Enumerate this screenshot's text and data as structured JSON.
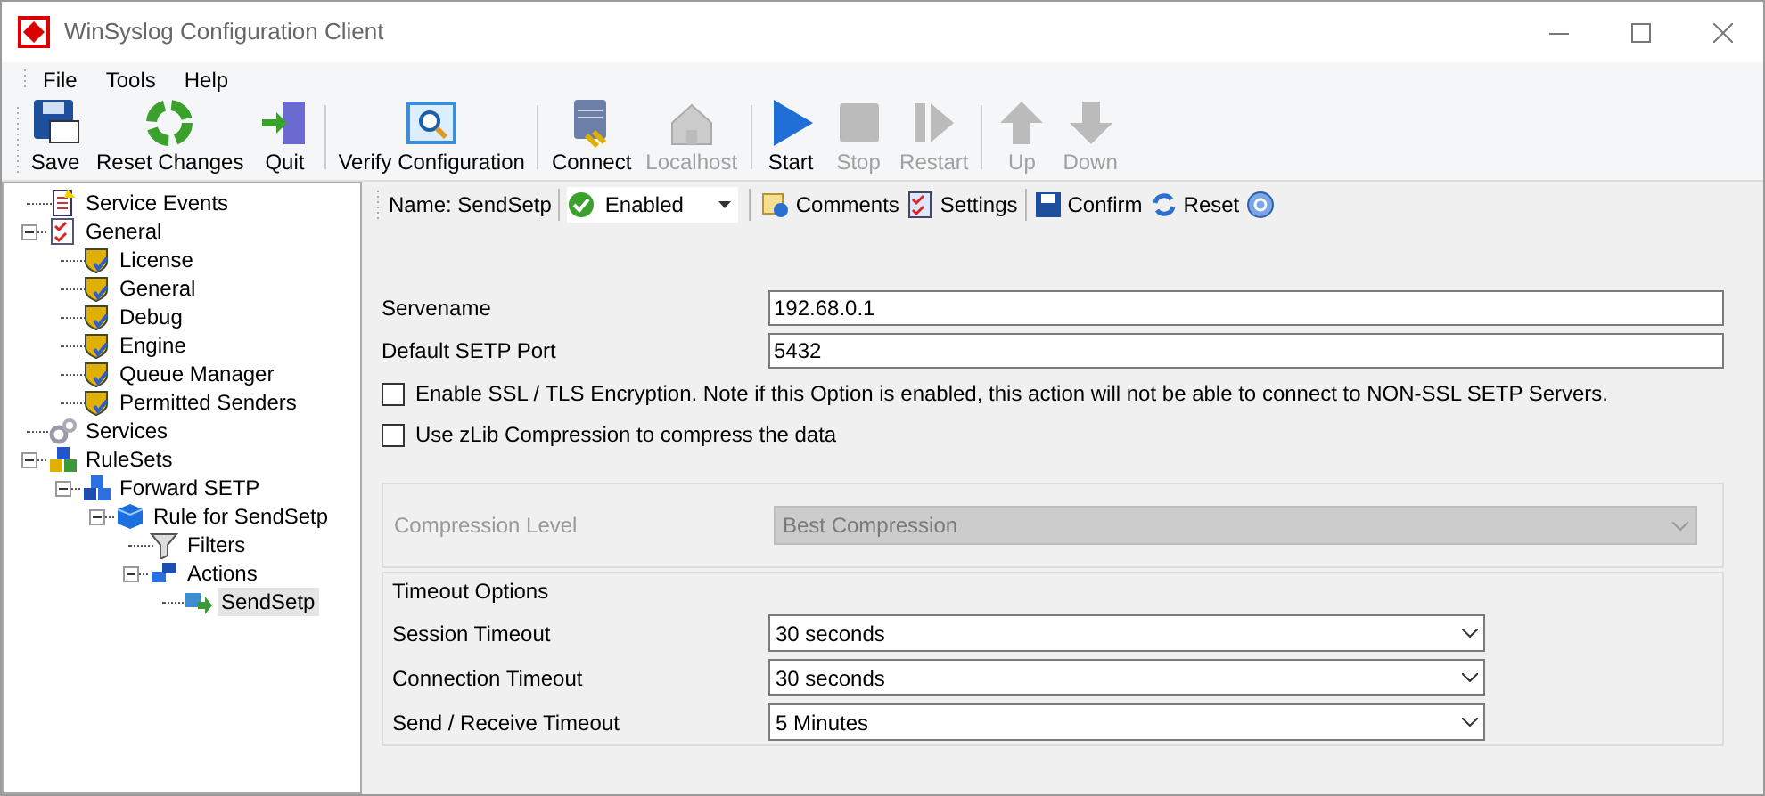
{
  "window": {
    "title": "WinSyslog Configuration Client"
  },
  "menu": [
    "File",
    "Tools",
    "Help"
  ],
  "toolbar": [
    [
      {
        "label": "Save",
        "disabled": false
      },
      {
        "label": "Reset Changes",
        "disabled": false
      },
      {
        "label": "Quit",
        "disabled": false
      }
    ],
    [
      {
        "label": "Verify Configuration",
        "disabled": false
      }
    ],
    [
      {
        "label": "Connect",
        "disabled": false
      },
      {
        "label": "Localhost",
        "disabled": true
      }
    ],
    [
      {
        "label": "Start",
        "disabled": false
      },
      {
        "label": "Stop",
        "disabled": true
      },
      {
        "label": "Restart",
        "disabled": true
      }
    ],
    [
      {
        "label": "Up",
        "disabled": true
      },
      {
        "label": "Down",
        "disabled": true
      }
    ]
  ],
  "tree": [
    {
      "label": "Service Events",
      "selected": false
    },
    {
      "label": "General",
      "selected": false,
      "expanded": true,
      "children": [
        {
          "label": "License",
          "selected": false
        },
        {
          "label": "General",
          "selected": false
        },
        {
          "label": "Debug",
          "selected": false
        },
        {
          "label": "Engine",
          "selected": false
        },
        {
          "label": "Queue Manager",
          "selected": false
        },
        {
          "label": "Permitted Senders",
          "selected": false
        }
      ]
    },
    {
      "label": "Services",
      "selected": false
    },
    {
      "label": "RuleSets",
      "selected": false,
      "expanded": true,
      "children": [
        {
          "label": "Forward SETP",
          "selected": false,
          "expanded": true,
          "children": [
            {
              "label": "Rule for SendSetp",
              "selected": false,
              "expanded": true,
              "children": [
                {
                  "label": "Filters",
                  "selected": false
                },
                {
                  "label": "Actions",
                  "selected": false,
                  "expanded": true,
                  "children": [
                    {
                      "label": "SendSetp",
                      "selected": true
                    }
                  ]
                }
              ]
            }
          ]
        }
      ]
    }
  ],
  "action_bar": {
    "name_label": "Name: SendSetp",
    "status": "Enabled",
    "buttons": [
      "Comments",
      "Settings",
      "Confirm",
      "Reset"
    ]
  },
  "form": {
    "fields": [
      {
        "label": "Servename",
        "value": "192.68.0.1"
      },
      {
        "label": "Default SETP Port",
        "value": "5432"
      }
    ],
    "checkboxes": [
      {
        "label": "Enable SSL / TLS Encryption. Note if this Option is enabled, this action will not be able to connect to NON-SSL SETP Servers.",
        "checked": false
      },
      {
        "label": "Use zLib Compression to compress the data",
        "checked": false
      }
    ],
    "compression": {
      "label": "Compression Level",
      "value": "Best Compression",
      "disabled": true
    },
    "timeout_group": {
      "title": "Timeout Options",
      "rows": [
        {
          "label": "Session Timeout",
          "value": "30 seconds"
        },
        {
          "label": "Connection Timeout",
          "value": "30 seconds"
        },
        {
          "label": "Send / Receive Timeout",
          "value": "5 Minutes"
        }
      ]
    }
  }
}
